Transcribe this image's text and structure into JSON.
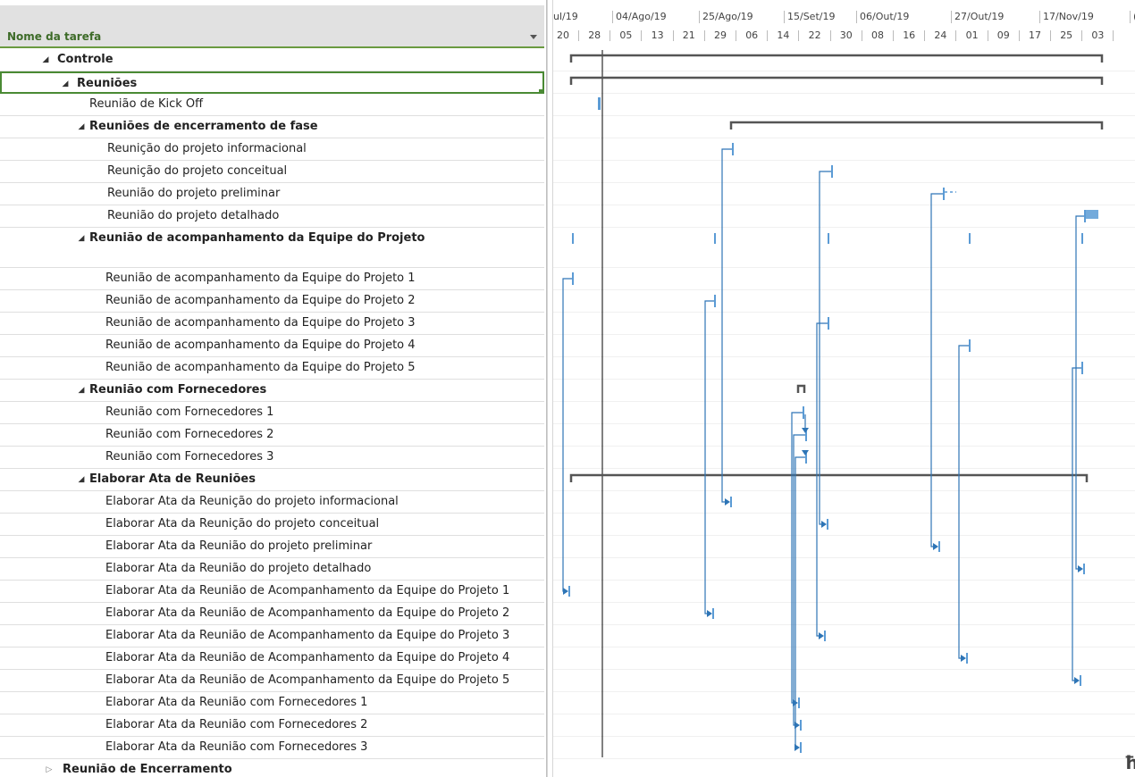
{
  "task_column": {
    "header": "Nome da tarefa"
  },
  "tasks": [
    {
      "name": "Controle",
      "summary": true,
      "expander": "expanded"
    },
    {
      "name": "Reuniões",
      "summary": true,
      "expander": "expanded",
      "selected": true
    },
    {
      "name": "Reunião de Kick Off"
    },
    {
      "name": "Reuniões de encerramento de fase",
      "summary": true,
      "expander": "expanded"
    },
    {
      "name": "Reunição do projeto informacional"
    },
    {
      "name": "Reunição do projeto conceitual"
    },
    {
      "name": "Reunião do projeto preliminar"
    },
    {
      "name": "Reunião do projeto detalhado"
    },
    {
      "name": "Reunião de acompanhamento da Equipe do Projeto",
      "summary": true,
      "expander": "expanded"
    },
    {
      "name": "Reunião de acompanhamento da Equipe do Projeto 1"
    },
    {
      "name": "Reunião de acompanhamento da Equipe do Projeto 2"
    },
    {
      "name": "Reunião de acompanhamento da Equipe do Projeto 3"
    },
    {
      "name": "Reunião de acompanhamento da Equipe do Projeto 4"
    },
    {
      "name": "Reunião de acompanhamento da Equipe do Projeto 5"
    },
    {
      "name": "Reunião com Fornecedores",
      "summary": true,
      "expander": "expanded"
    },
    {
      "name": "Reunião com Fornecedores 1"
    },
    {
      "name": "Reunião com Fornecedores 2"
    },
    {
      "name": "Reunião com Fornecedores 3"
    },
    {
      "name": "Elaborar Ata de Reuniões",
      "summary": true,
      "expander": "expanded"
    },
    {
      "name": "Elaborar Ata da Reunição do projeto informacional"
    },
    {
      "name": "Elaborar Ata da Reunição do projeto conceitual"
    },
    {
      "name": "Elaborar Ata da Reunião do projeto preliminar"
    },
    {
      "name": "Elaborar Ata da Reunião do projeto detalhado"
    },
    {
      "name": "Elaborar Ata da Reunião de Acompanhamento da Equipe do Projeto 1"
    },
    {
      "name": "Elaborar Ata da Reunião de Acompanhamento da Equipe do Projeto 2"
    },
    {
      "name": "Elaborar Ata da Reunião de Acompanhamento da Equipe do Projeto 3"
    },
    {
      "name": "Elaborar Ata da Reunião de Acompanhamento da Equipe do Projeto 4"
    },
    {
      "name": "Elaborar Ata da Reunião de Acompanhamento da Equipe do Projeto 5"
    },
    {
      "name": "Elaborar Ata da Reunião com Fornecedores 1"
    },
    {
      "name": "Elaborar Ata da Reunião com Fornecedores 2"
    },
    {
      "name": "Elaborar Ata da Reunião com Fornecedores 3"
    },
    {
      "name": "Reunião de Encerramento",
      "summary": true,
      "expander": "collapsed"
    }
  ],
  "timescale": {
    "top_tier": [
      "ul/19",
      "04/Ago/19",
      "25/Ago/19",
      "15/Set/19",
      "06/Out/19",
      "27/Out/19",
      "17/Nov/19",
      "("
    ],
    "bottom_tier": [
      "20",
      "28",
      "05",
      "13",
      "21",
      "29",
      "06",
      "14",
      "22",
      "30",
      "08",
      "16",
      "24",
      "01",
      "09",
      "17",
      "25",
      "03"
    ]
  },
  "corner_glyph": "ħ",
  "colors": {
    "header_text": "#3d6b28",
    "header_underline": "#6a9a40",
    "selection_border": "#4a8a34",
    "summary_bar": "#555555",
    "task_bar": "#5b9bd5",
    "link_line": "#2e75b6",
    "status_date_line": "#000000"
  }
}
